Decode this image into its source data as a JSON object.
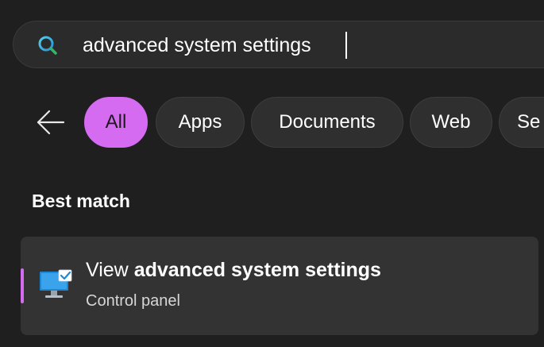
{
  "search": {
    "value": "advanced system settings",
    "icon": "search-icon"
  },
  "filters": {
    "back_icon": "back-arrow-icon",
    "chips": [
      {
        "label": "All",
        "active": true
      },
      {
        "label": "Apps",
        "active": false
      },
      {
        "label": "Documents",
        "active": false
      },
      {
        "label": "Web",
        "active": false
      },
      {
        "label": "Se",
        "active": false
      }
    ]
  },
  "best_match": {
    "title": "Best match",
    "result": {
      "title_prefix": "View ",
      "title_bold": "advanced system settings",
      "subtitle": "Control panel",
      "icon": "system-settings-monitor-icon"
    }
  },
  "colors": {
    "accent": "#d56bf0",
    "background": "#1f1f1f",
    "card": "#333333"
  }
}
